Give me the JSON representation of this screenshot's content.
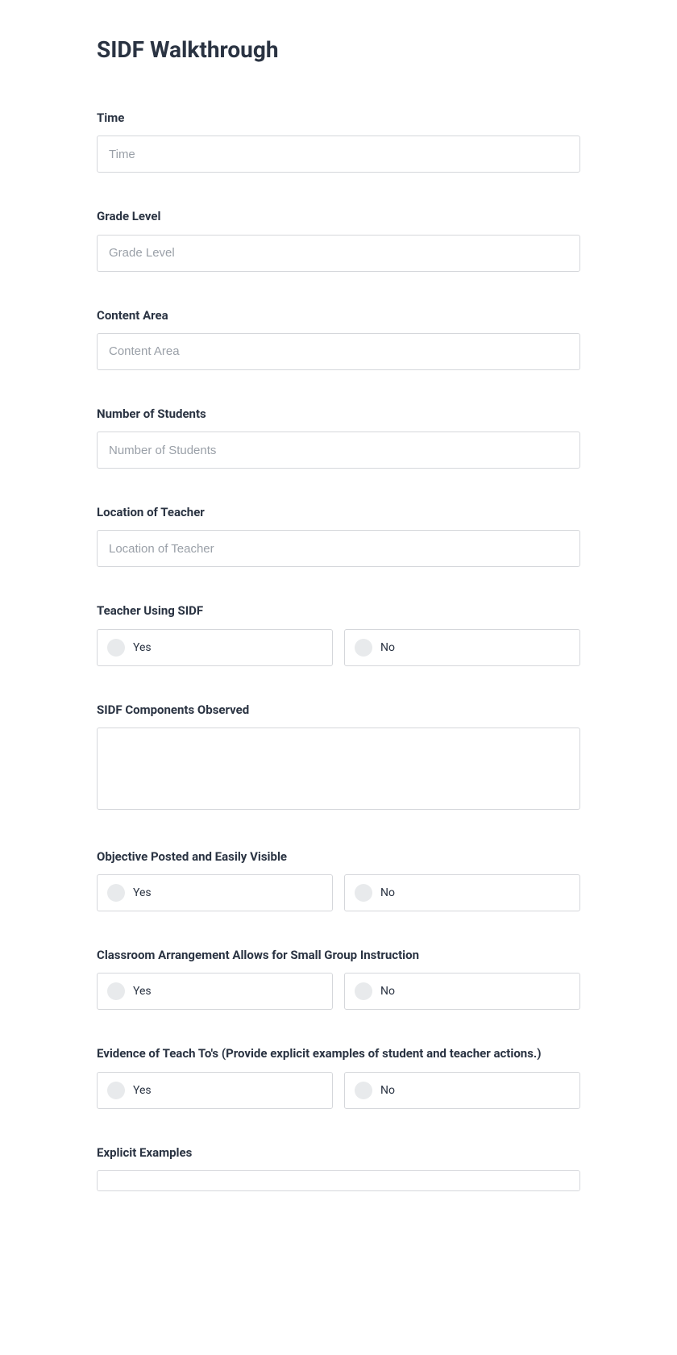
{
  "title": "SIDF Walkthrough",
  "fields": {
    "time": {
      "label": "Time",
      "placeholder": "Time"
    },
    "grade_level": {
      "label": "Grade Level",
      "placeholder": "Grade Level"
    },
    "content_area": {
      "label": "Content Area",
      "placeholder": "Content Area"
    },
    "number_of_students": {
      "label": "Number of Students",
      "placeholder": "Number of Students"
    },
    "location_of_teacher": {
      "label": "Location of Teacher",
      "placeholder": "Location of Teacher"
    },
    "teacher_using_sidf": {
      "label": "Teacher Using SIDF",
      "yes": "Yes",
      "no": "No"
    },
    "sidf_components": {
      "label": "SIDF Components Observed"
    },
    "objective_posted": {
      "label": "Objective Posted and Easily Visible",
      "yes": "Yes",
      "no": "No"
    },
    "classroom_arrangement": {
      "label": "Classroom Arrangement Allows for Small Group Instruction",
      "yes": "Yes",
      "no": "No"
    },
    "evidence_teach_tos": {
      "label": "Evidence of Teach To's (Provide explicit examples of student and teacher actions.)",
      "yes": "Yes",
      "no": "No"
    },
    "explicit_examples": {
      "label": "Explicit Examples"
    }
  }
}
